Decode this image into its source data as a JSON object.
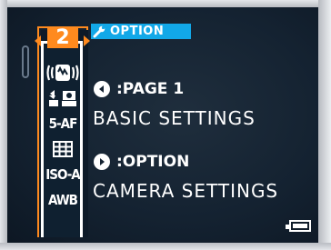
{
  "header": {
    "option_label": "OPTION",
    "page_number": "2"
  },
  "sidebar": {
    "icons": [
      {
        "name": "image-stabilizer-icon"
      },
      {
        "name": "scene-mode-icon"
      },
      {
        "name": "focus-mode-icon",
        "text": "5-AF"
      },
      {
        "name": "grid-icon"
      },
      {
        "name": "iso-icon",
        "text": "ISO-A"
      },
      {
        "name": "white-balance-icon",
        "text": "AWB"
      }
    ]
  },
  "main": {
    "page_key_label": ":PAGE 1",
    "page_desc": "BASIC SETTINGS",
    "option_key_label": ":OPTION",
    "option_desc": "CAMERA SETTINGS"
  },
  "status": {
    "battery_icon": "battery-full-icon"
  },
  "colors": {
    "accent_orange": "#ff8a1e",
    "header_blue": "#12a8e8",
    "screen_bg": "#142231"
  }
}
